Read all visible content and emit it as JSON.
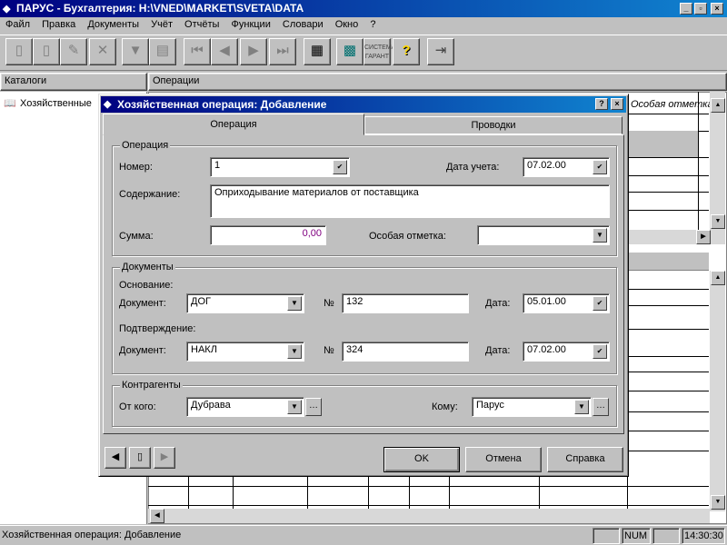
{
  "window": {
    "title": "ПАРУС - Бухгалтерия: H:\\VNED\\MARKET\\SVETA\\DATA"
  },
  "menu": [
    "Файл",
    "Правка",
    "Документы",
    "Учёт",
    "Отчёты",
    "Функции",
    "Словари",
    "Окно",
    "?"
  ],
  "toolbar": {
    "icons": [
      "new-icon",
      "copy-icon",
      "edit-icon",
      "delete-icon",
      "filter-icon",
      "print-icon",
      "first-icon",
      "prev-icon",
      "next-icon",
      "last-icon",
      "marks-icon",
      "calculator-icon",
      "garant-icon",
      "help-icon",
      "exit-icon"
    ],
    "garant_label": "СИСТЕМА ГАРАНТ"
  },
  "panels": {
    "catalogs": "Каталоги",
    "operations": "Операции",
    "tree_item": "Хозяйственные",
    "column_header": "Особая отметка"
  },
  "dialog": {
    "title": "Хозяйственная операция: Добавление",
    "tabs": [
      "Операция",
      "Проводки"
    ],
    "operation": {
      "group": "Операция",
      "number_label": "Номер:",
      "number_value": "1",
      "date_label": "Дата учета:",
      "date_value": "07.02.00",
      "content_label": "Содержание:",
      "content_value": "Оприходывание материалов от поставщика",
      "sum_label": "Сумма:",
      "sum_value": "0,00",
      "mark_label": "Особая отметка:",
      "mark_value": ""
    },
    "documents": {
      "group": "Документы",
      "basis_label": "Основание:",
      "doc_label": "Документ:",
      "basis_doc": "ДОГ",
      "num_label": "№",
      "basis_num": "132",
      "date_label": "Дата:",
      "basis_date": "05.01.00",
      "confirm_label": "Подтверждение:",
      "confirm_doc": "НАКЛ",
      "confirm_num": "324",
      "confirm_date": "07.02.00"
    },
    "contractors": {
      "group": "Контрагенты",
      "from_label": "От кого:",
      "from_value": "Дубрава",
      "to_label": "Кому:",
      "to_value": "Парус"
    },
    "buttons": {
      "ok": "OK",
      "cancel": "Отмена",
      "help": "Справка"
    }
  },
  "statusbar": {
    "text": "Хозяйственная операция: Добавление",
    "num": "NUM",
    "time": "14:30:30"
  }
}
